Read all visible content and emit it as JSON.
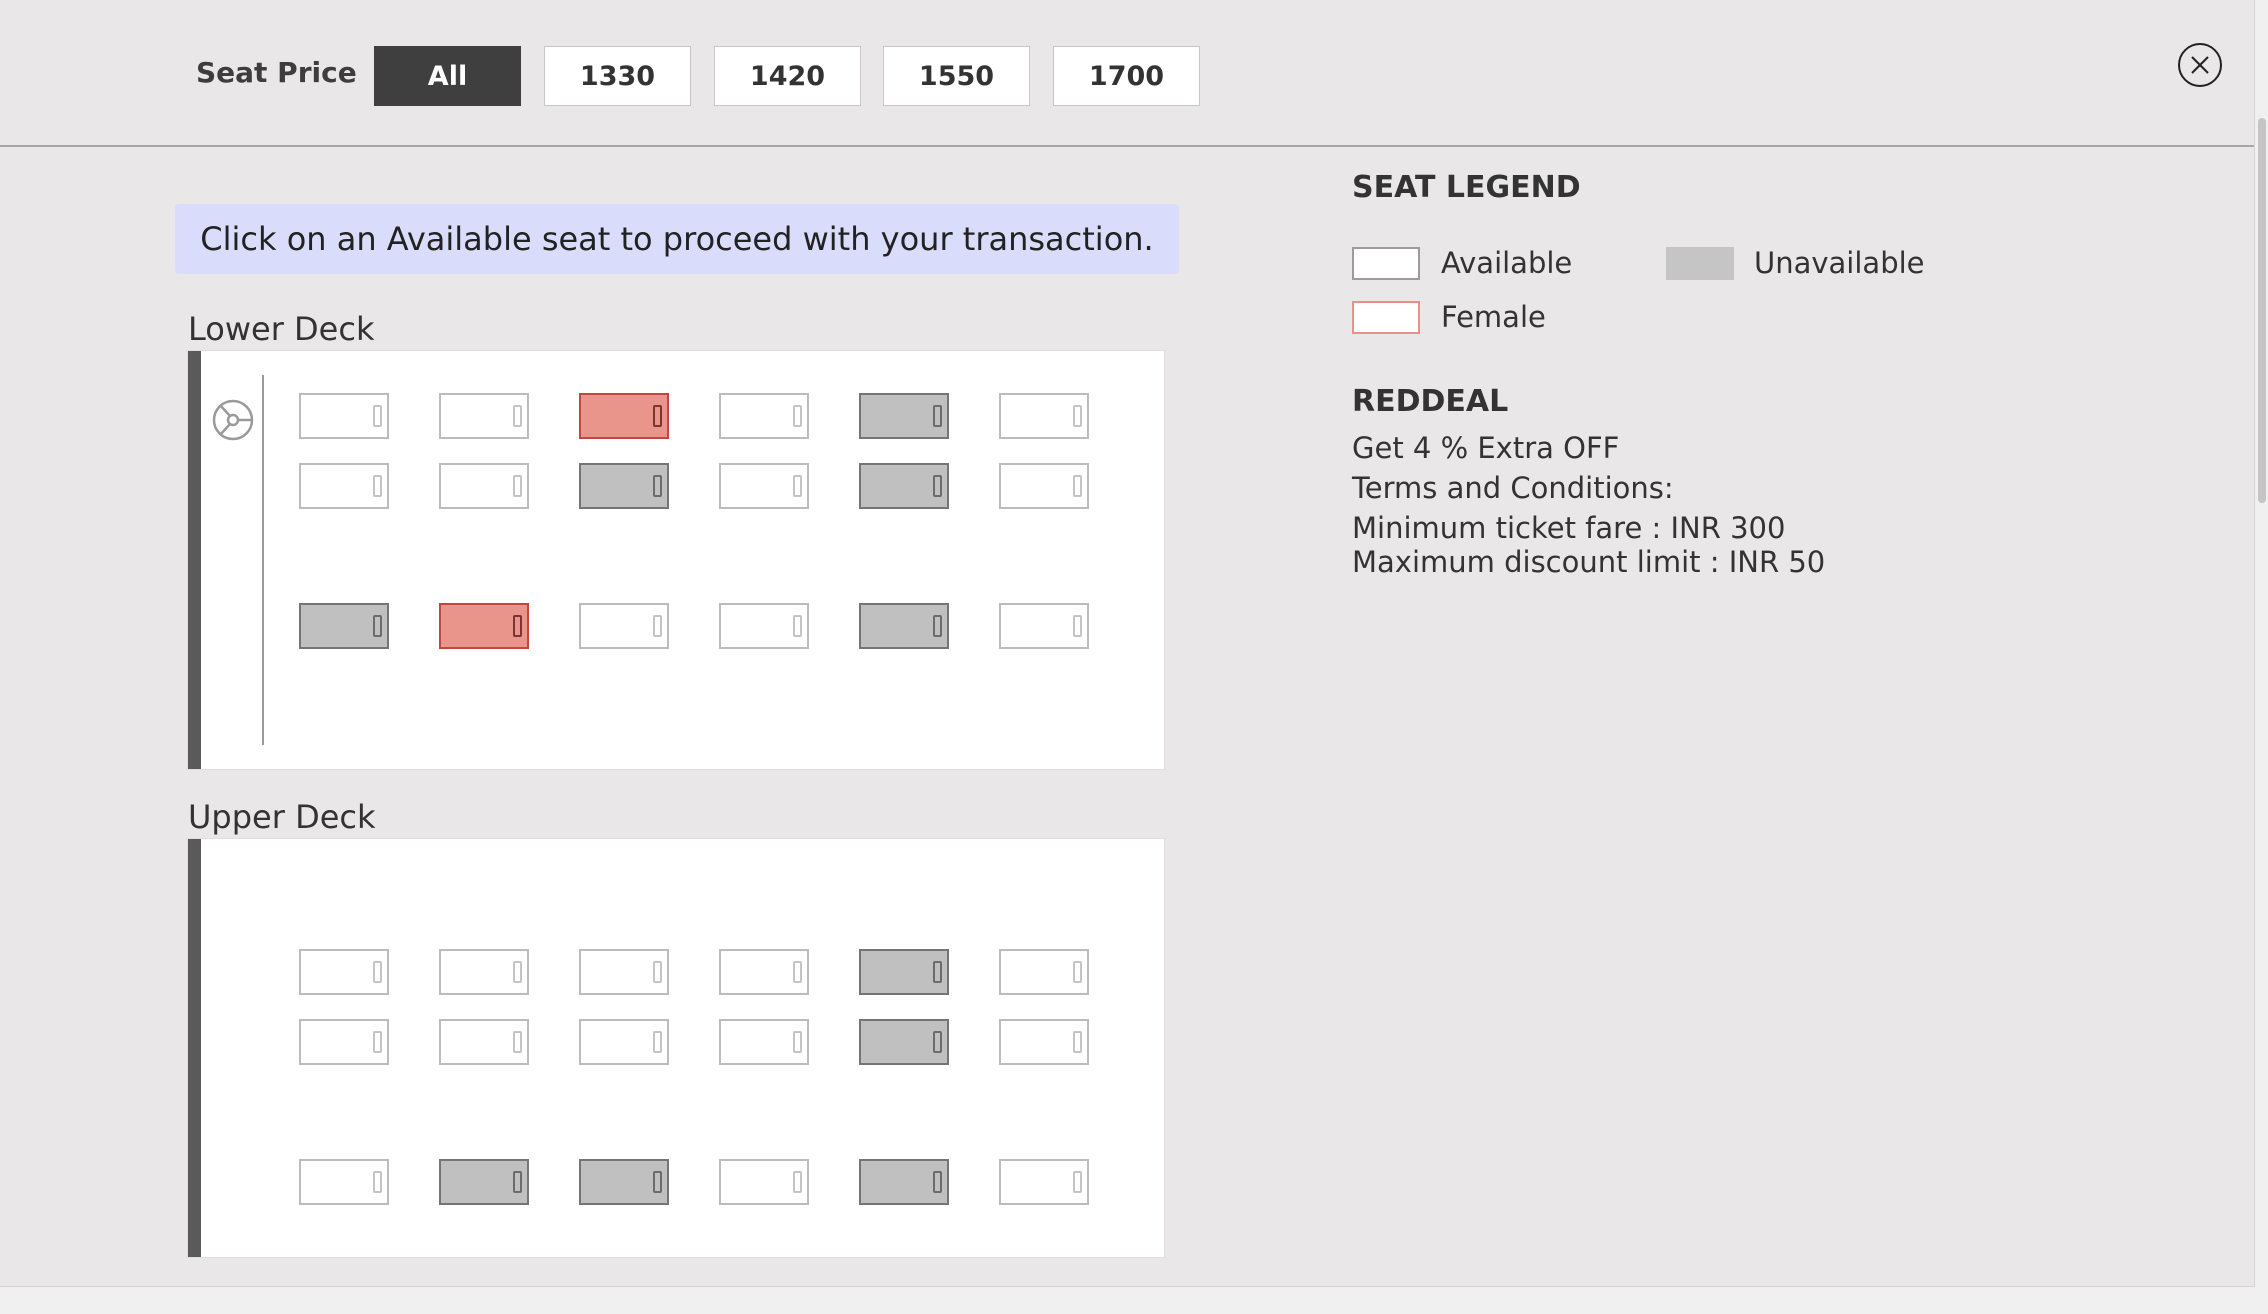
{
  "seat_price": {
    "label": "Seat Price",
    "options": [
      "All",
      "1330",
      "1420",
      "1550",
      "1700"
    ],
    "selected": "All"
  },
  "banner": "Click on an Available seat to proceed with your transaction.",
  "lower_deck": {
    "title": "Lower Deck",
    "rows": [
      [
        "available",
        "available",
        "female",
        "available",
        "unavailable",
        "available"
      ],
      [
        "available",
        "available",
        "unavailable",
        "available",
        "unavailable",
        "available"
      ],
      [
        "unavailable",
        "female",
        "available",
        "available",
        "unavailable",
        "available"
      ]
    ]
  },
  "upper_deck": {
    "title": "Upper Deck",
    "rows": [
      [
        "available",
        "available",
        "available",
        "available",
        "unavailable",
        "available"
      ],
      [
        "available",
        "available",
        "available",
        "available",
        "unavailable",
        "available"
      ],
      [
        "available",
        "unavailable",
        "unavailable",
        "available",
        "unavailable",
        "available"
      ]
    ]
  },
  "legend": {
    "title": "SEAT LEGEND",
    "available": "Available",
    "unavailable": "Unavailable",
    "female": "Female"
  },
  "deal": {
    "title": "REDDEAL",
    "offer": "Get 4 % Extra OFF",
    "terms_heading": "Terms and Conditions:",
    "min_fare": "Minimum ticket fare : INR 300",
    "max_discount": "Maximum discount limit : INR 50"
  },
  "colors": {
    "available": "#ffffff",
    "unavailable": "#c0c0c0",
    "female": "#ea958c",
    "banner": "#dadcfb",
    "active_button": "#3f3f3f"
  },
  "icons": [
    "steering-wheel-icon",
    "close-icon",
    "berth-pillow-icon"
  ]
}
